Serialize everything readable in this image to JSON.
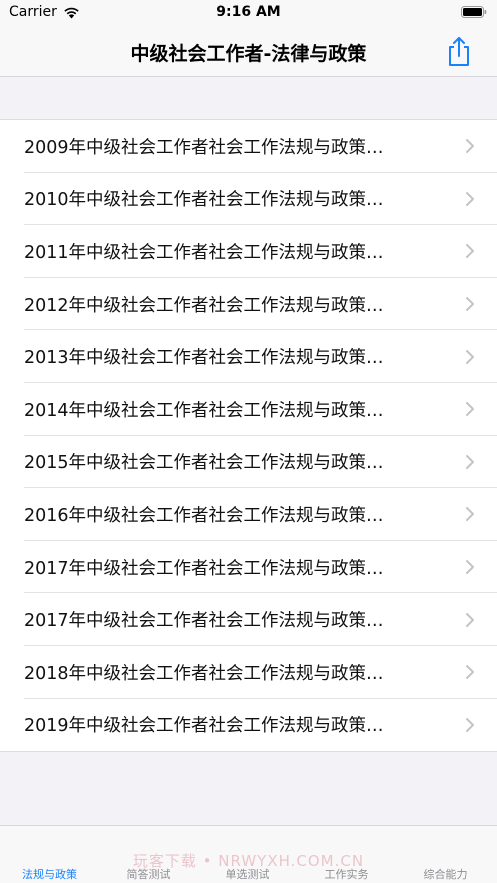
{
  "status_bar": {
    "carrier": "Carrier",
    "time": "9:16 AM"
  },
  "nav": {
    "title": "中级社会工作者-法律与政策",
    "share_icon": "share-icon"
  },
  "colors": {
    "accent": "#1a82fb",
    "background": "#f2f2f7"
  },
  "list": {
    "items": [
      {
        "label": "2009年中级社会工作者社会工作法规与政策…"
      },
      {
        "label": "2010年中级社会工作者社会工作法规与政策…"
      },
      {
        "label": "2011年中级社会工作者社会工作法规与政策…"
      },
      {
        "label": "2012年中级社会工作者社会工作法规与政策…"
      },
      {
        "label": "2013年中级社会工作者社会工作法规与政策…"
      },
      {
        "label": "2014年中级社会工作者社会工作法规与政策…"
      },
      {
        "label": "2015年中级社会工作者社会工作法规与政策…"
      },
      {
        "label": "2016年中级社会工作者社会工作法规与政策…"
      },
      {
        "label": "2017年中级社会工作者社会工作法规与政策…"
      },
      {
        "label": "2017年中级社会工作者社会工作法规与政策…"
      },
      {
        "label": "2018年中级社会工作者社会工作法规与政策…"
      },
      {
        "label": "2019年中级社会工作者社会工作法规与政策…"
      }
    ]
  },
  "tabs": [
    {
      "label": "法规与政策",
      "active": true
    },
    {
      "label": "简答测试",
      "active": false
    },
    {
      "label": "单选测试",
      "active": false
    },
    {
      "label": "工作实务",
      "active": false
    },
    {
      "label": "综合能力",
      "active": false
    }
  ],
  "watermark": "玩客下载 • NRWYXH.COM.CN"
}
